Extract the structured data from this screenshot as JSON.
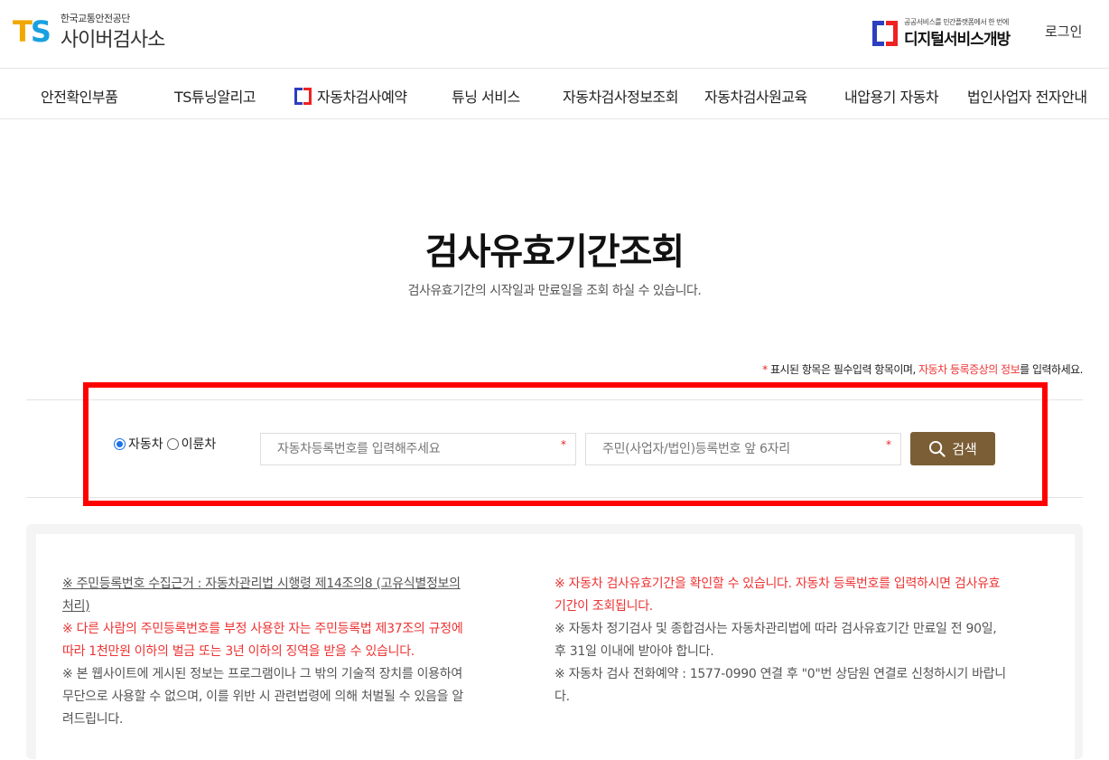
{
  "header": {
    "logo_ts_t": "T",
    "logo_ts_s": "S",
    "logo_sub": "한국교통안전공단",
    "logo_main": "사이버검사소",
    "digital_sub": "공공서비스를 민간플랫폼에서 한 번에",
    "digital_main": "디지털서비스개방",
    "login": "로그인"
  },
  "nav": {
    "items": [
      {
        "label": "안전확인부품"
      },
      {
        "label": "TS튜닝알리고"
      },
      {
        "label": "자동차검사예약"
      },
      {
        "label": "튜닝 서비스"
      },
      {
        "label": "자동차검사정보조회"
      },
      {
        "label": "자동차검사원교육"
      },
      {
        "label": "내압용기 자동차"
      },
      {
        "label": "법인사업자 전자안내"
      }
    ]
  },
  "main": {
    "title": "검사유효기간조회",
    "description": "검사유효기간의 시작일과 만료일을 조회 하실 수 있습니다.",
    "required_note": {
      "star": "*",
      "text1": " 표시된 항목은 필수입력 항목이며, ",
      "red_text": "자동차 등록증상의 정보",
      "text2": "를 입력하세요."
    }
  },
  "search": {
    "radio_car": "자동차",
    "radio_twowheel": "이륜차",
    "selected": "자동차",
    "reg_number_placeholder": "자동차등록번호를 입력해주세요",
    "id_placeholder": "주민(사업자/법인)등록번호 앞 6자리",
    "required_star": "*",
    "button_label": "검색"
  },
  "info": {
    "left": {
      "line1a": "※ 주민등록번호 수집근거 : 자동차관리법 시행령 제14조의8 (고유식별정보의",
      "line1b": "처리)",
      "line2a": "※ 다른 사람의 주민등록번호를 부정 사용한 자는 주민등록법 제37조의 규정에",
      "line2b": "따라 1천만원 이하의 벌금 또는 3년 이하의 징역을 받을 수 있습니다.",
      "line3a": "※ 본 웹사이트에 게시된 정보는 프로그램이나 그 밖의 기술적 장치를 이용하여",
      "line3b": "무단으로 사용할 수 없으며, 이를 위반 시 관련법령에 의해 처벌될 수 있음을 알",
      "line3c": "려드립니다."
    },
    "right": {
      "line1a": "※ 자동차 검사유효기간을 확인할 수 있습니다. 자동차 등록번호를 입력하시면 검사유효",
      "line1b": "기간이 조회됩니다.",
      "line2a": "※ 자동차 정기검사 및 종합검사는 자동차관리법에 따라 검사유효기간 만료일 전 90일,",
      "line2b": "후 31일 이내에 받아야 합니다.",
      "line3a": "※ 자동차 검사 전화예약 : 1577-0990 연결 후 \"0\"번 상담원 연결로 신청하시기 바랍니",
      "line3b": "다."
    }
  },
  "colors": {
    "accent_red": "#e33333",
    "button_brown": "#7b5e35",
    "highlight_red": "#ff0000",
    "logo_t": "#f0a800",
    "logo_s": "#1aa0e0"
  }
}
